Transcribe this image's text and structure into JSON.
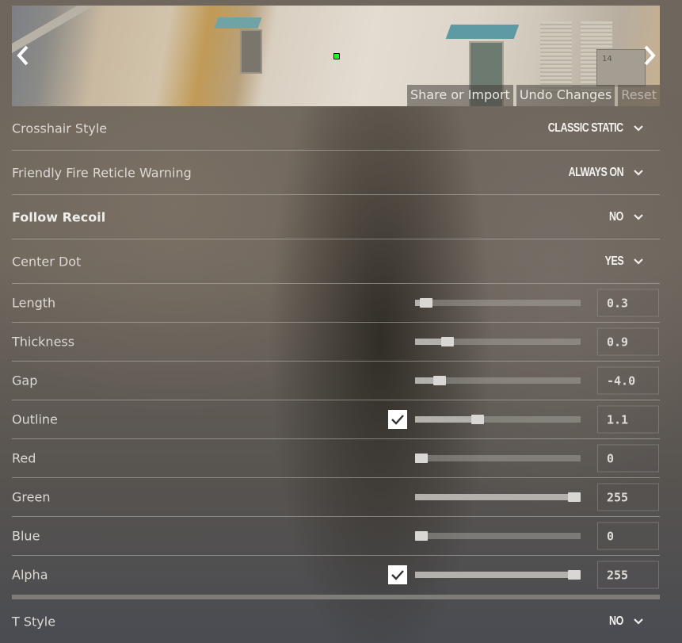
{
  "preview": {
    "crate_label": "14",
    "buttons": {
      "share": "Share or Import",
      "undo": "Undo Changes",
      "reset": "Reset"
    },
    "crosshair_color": "#00ff00"
  },
  "dropdowns": [
    {
      "label": "Crosshair Style",
      "value": "Classic Static",
      "bold": false
    },
    {
      "label": "Friendly Fire Reticle Warning",
      "value": "Always On",
      "bold": false
    },
    {
      "label": "Follow Recoil",
      "value": "No",
      "bold": true
    },
    {
      "label": "Center Dot",
      "value": "Yes",
      "bold": false
    }
  ],
  "sliders": [
    {
      "label": "Length",
      "value": "0.3",
      "fraction": 0.03,
      "checkbox": null
    },
    {
      "label": "Thickness",
      "value": "0.9",
      "fraction": 0.17,
      "checkbox": null
    },
    {
      "label": "Gap",
      "value": "-4.0",
      "fraction": 0.12,
      "checkbox": null
    },
    {
      "label": "Outline",
      "value": "1.1",
      "fraction": 0.37,
      "checkbox": true
    },
    {
      "label": "Red",
      "value": "0",
      "fraction": 0.0,
      "checkbox": null
    },
    {
      "label": "Green",
      "value": "255",
      "fraction": 1.0,
      "checkbox": null
    },
    {
      "label": "Blue",
      "value": "0",
      "fraction": 0.0,
      "checkbox": null
    },
    {
      "label": "Alpha",
      "value": "255",
      "fraction": 1.0,
      "checkbox": true
    }
  ],
  "tstyle": {
    "label": "T Style",
    "value": "No"
  }
}
